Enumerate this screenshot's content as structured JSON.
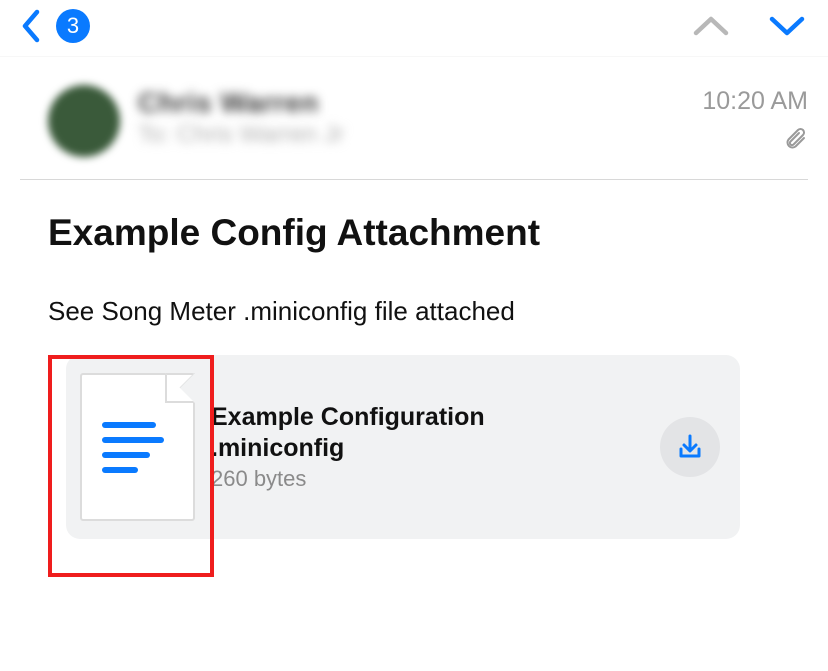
{
  "toolbar": {
    "badge_count": "3"
  },
  "message": {
    "sender_name": "Chris Warren",
    "recipient_line": "To: Chris Warren Jr",
    "timestamp": "10:20 AM",
    "subject": "Example Config Attachment",
    "body": "See Song Meter .miniconfig file attached"
  },
  "attachment": {
    "name_line1": "Example Configuration",
    "name_line2": ".miniconfig",
    "size": "260 bytes"
  }
}
